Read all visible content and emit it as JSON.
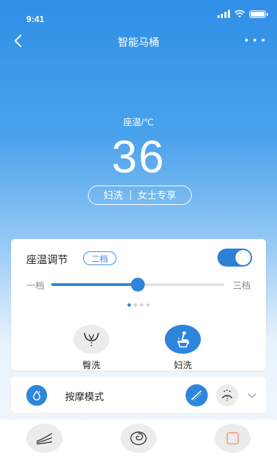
{
  "status_bar": {
    "time": "9:41"
  },
  "nav": {
    "title": "智能马桶"
  },
  "hero": {
    "temp_label": "座温/℃",
    "temp_value": "36",
    "mode_pill": {
      "left": "妇洗",
      "right": "女士专享"
    }
  },
  "seat_card": {
    "title": "座温调节",
    "level_badge": "二档",
    "toggle_on": true,
    "slider": {
      "min_label": "一档",
      "max_label": "三档",
      "fraction": 0.5
    },
    "page_dots": 4,
    "active_dot": 0,
    "wash_buttons": [
      {
        "label": "臀洗",
        "icon": "hip-wash-icon",
        "active": false
      },
      {
        "label": "妇洗",
        "icon": "feminine-wash-icon",
        "active": true
      }
    ]
  },
  "massage": {
    "label": "按摩模式",
    "icon": "water-drop-icon",
    "options": [
      "spray-wand-icon",
      "shower-spray-icon"
    ]
  },
  "bottom_bar": {
    "buttons": [
      "dry-wind-icon",
      "swirl-flush-icon",
      "stop-square-icon"
    ]
  },
  "colors": {
    "accent": "#2e86dc",
    "stop_orange": "#f29a6a"
  }
}
